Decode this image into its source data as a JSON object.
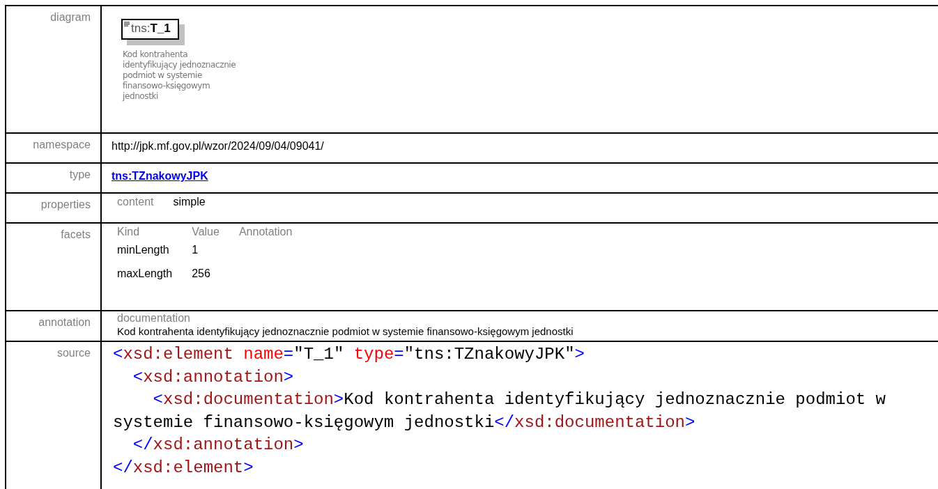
{
  "diagram": {
    "label": "diagram",
    "prefix": "tns:",
    "name": "T_1",
    "description": "Kod kontrahenta\nidentyfikujący jednoznacznie\npodmiot w systemie\nfinansowo-księgowym\njednostki"
  },
  "namespace": {
    "label": "namespace",
    "value": "http://jpk.mf.gov.pl/wzor/2024/09/04/09041/"
  },
  "type": {
    "label": "type",
    "value": "tns:TZnakowyJPK"
  },
  "properties": {
    "label": "properties",
    "items": [
      {
        "name": "content",
        "value": "simple"
      }
    ]
  },
  "facets": {
    "label": "facets",
    "columns": [
      "Kind",
      "Value",
      "Annotation"
    ],
    "rows": [
      {
        "kind": "minLength",
        "value": "1"
      },
      {
        "kind": "maxLength",
        "value": "256"
      }
    ]
  },
  "annotation": {
    "label": "annotation",
    "heading": "documentation",
    "text": "Kod kontrahenta identyfikujący jednoznacznie podmiot w systemie finansowo-księgowym jednostki"
  },
  "source": {
    "label": "source",
    "lines": [
      [
        {
          "kind": "bracket",
          "text": "<"
        },
        {
          "kind": "tag",
          "text": "xsd:element"
        },
        {
          "kind": "attr",
          "text": " name"
        },
        {
          "kind": "bracket",
          "text": "="
        },
        {
          "kind": "text",
          "text": "\"T_1\""
        },
        {
          "kind": "attr",
          "text": " type"
        },
        {
          "kind": "bracket",
          "text": "="
        },
        {
          "kind": "text",
          "text": "\"tns:TZnakowyJPK\""
        },
        {
          "kind": "bracket",
          "text": ">"
        }
      ],
      [
        {
          "kind": "bracket",
          "text": "  <"
        },
        {
          "kind": "tag",
          "text": "xsd:annotation"
        },
        {
          "kind": "bracket",
          "text": ">"
        }
      ],
      [
        {
          "kind": "bracket",
          "text": "    <"
        },
        {
          "kind": "tag",
          "text": "xsd:documentation"
        },
        {
          "kind": "bracket",
          "text": ">"
        },
        {
          "kind": "text",
          "text": "Kod kontrahenta identyfikujący jednoznacznie podmiot w"
        }
      ],
      [
        {
          "kind": "text",
          "text": "systemie finansowo-księgowym jednostki"
        },
        {
          "kind": "bracket",
          "text": "</"
        },
        {
          "kind": "tag",
          "text": "xsd:documentation"
        },
        {
          "kind": "bracket",
          "text": ">"
        }
      ],
      [
        {
          "kind": "bracket",
          "text": "  </"
        },
        {
          "kind": "tag",
          "text": "xsd:annotation"
        },
        {
          "kind": "bracket",
          "text": ">"
        }
      ],
      [
        {
          "kind": "bracket",
          "text": "</"
        },
        {
          "kind": "tag",
          "text": "xsd:element"
        },
        {
          "kind": "bracket",
          "text": ">"
        }
      ]
    ]
  }
}
